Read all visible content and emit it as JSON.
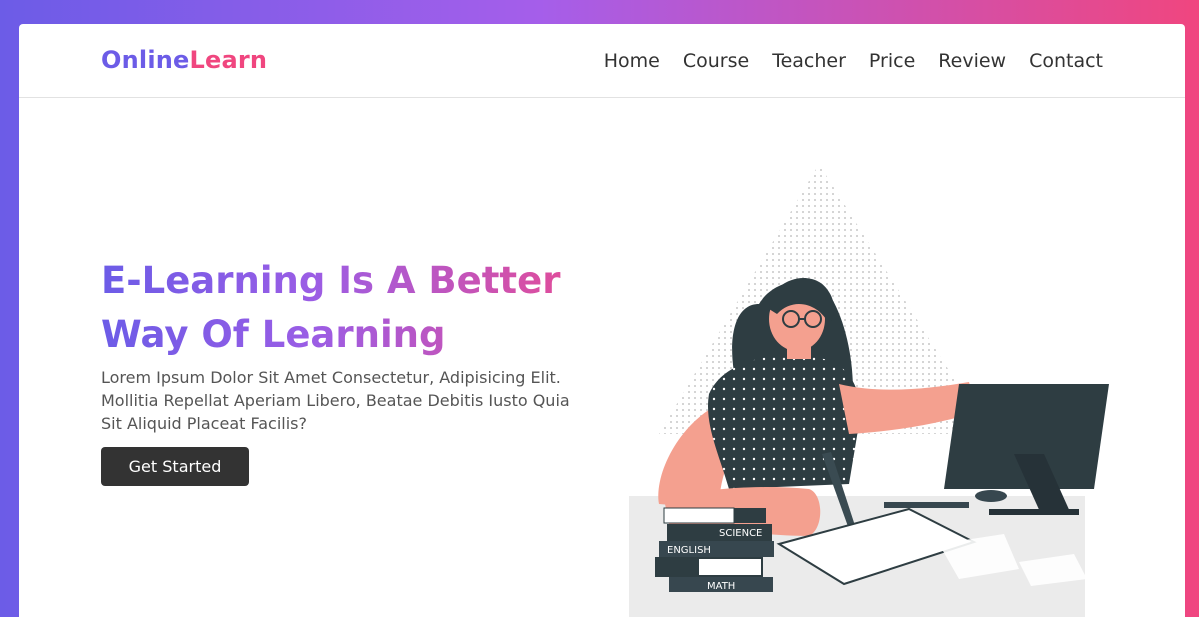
{
  "brand": {
    "part1": "Online",
    "part2": "Learn"
  },
  "nav": [
    "Home",
    "Course",
    "Teacher",
    "Price",
    "Review",
    "Contact"
  ],
  "hero": {
    "headline_line1": "E-Learning Is A Better",
    "headline_line2": "Way Of Learning",
    "description": "Lorem Ipsum Dolor Sit Amet Consectetur, Adipisicing Elit. Mollitia Repellat Aperiam Libero, Beatae Debitis Iusto Quia Sit Aliquid Placeat Facilis?",
    "cta": "Get Started"
  },
  "illustration": {
    "book_labels": [
      "SCIENCE",
      "ENGLISH",
      "MATH"
    ]
  },
  "colors": {
    "brand_purple": "#6c5ce7",
    "brand_pink": "#f0467f",
    "button_dark": "#333333"
  }
}
